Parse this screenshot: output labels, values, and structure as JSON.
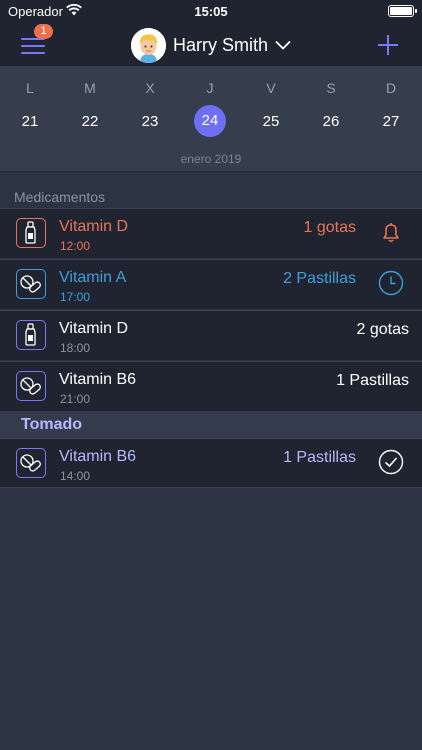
{
  "status_bar": {
    "carrier": "Operador",
    "time": "15:05"
  },
  "nav": {
    "menu_badge": "1",
    "profile_name": "Harry Smith"
  },
  "calendar": {
    "days": [
      {
        "letter": "L",
        "number": "21"
      },
      {
        "letter": "M",
        "number": "22"
      },
      {
        "letter": "X",
        "number": "23"
      },
      {
        "letter": "J",
        "number": "24",
        "selected": true
      },
      {
        "letter": "V",
        "number": "25"
      },
      {
        "letter": "S",
        "number": "26"
      },
      {
        "letter": "D",
        "number": "27"
      }
    ],
    "month_label": "enero 2019"
  },
  "sections": {
    "medications_title": "Medicamentos",
    "taken_title": "Tomado"
  },
  "medications": [
    {
      "name": "Vitamin D",
      "time": "12:00",
      "dose": "1 gotas",
      "icon": "dropper-icon",
      "status": "alert",
      "status_icon": "bell-icon"
    },
    {
      "name": "Vitamin A",
      "time": "17:00",
      "dose": "2 Pastillas",
      "icon": "pills-icon",
      "status": "pending",
      "status_icon": "clock-icon"
    },
    {
      "name": "Vitamin D",
      "time": "18:00",
      "dose": "2 gotas",
      "icon": "dropper-icon",
      "status": "normal",
      "status_icon": ""
    },
    {
      "name": "Vitamin B6",
      "time": "21:00",
      "dose": "1 Pastillas",
      "icon": "pills-icon",
      "status": "normal",
      "status_icon": ""
    }
  ],
  "taken": [
    {
      "name": "Vitamin B6",
      "time": "14:00",
      "dose": "1 Pastillas",
      "icon": "pills-icon",
      "status_icon": "checkmark-circle-icon"
    }
  ],
  "colors": {
    "accent": "#7b78f5",
    "alert": "#e9745a",
    "pending": "#3f9fd9",
    "taken_header": "#b7b9ff",
    "background": "#2c3342"
  }
}
